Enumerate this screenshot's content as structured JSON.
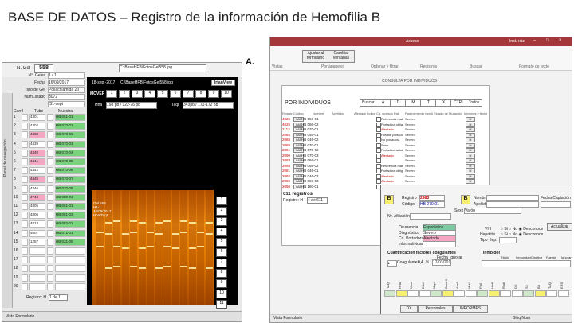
{
  "title": "BASE DE DATOS – Registro de la información de Hemofilia B",
  "labels": {
    "a": "A.",
    "b": "B."
  },
  "panel_a": {
    "gel_label": "N. Gel",
    "gel_value": "558",
    "file_path": "C:\\BaseHFB\\FotosGel558.jpg",
    "form_fields": [
      {
        "label": "N°. Geles",
        "value": "1 / 1"
      },
      {
        "label": "Fecha",
        "value": "16/09/2017"
      },
      {
        "label": "Tipo de Gel",
        "value": "Poliacrilamida 20"
      },
      {
        "label": "NumListado",
        "value": "3072"
      },
      {
        "label": "",
        "value": "/31-sept"
      }
    ],
    "viewer_date": "18-sep.-2017",
    "viewer_path": "C:\\BaseHFB\\FotosGel558.jpg",
    "viewer_button": "IrfanView",
    "mover_label": "MOVER",
    "mover_buttons": [
      "1",
      "2",
      "3",
      "4",
      "5",
      "6",
      "7",
      "8",
      "9",
      "10"
    ],
    "hha_label": "Hha",
    "hha_value": "198 pb / 122-76 pb",
    "taq_label": "TaqI",
    "taq_value": "343pb / 171-172 pb",
    "gel_overlay": [
      "Gel 558",
      "H1-1",
      "16/09/2017",
      "Hha/TaqI"
    ],
    "table_headers": [
      "Carril",
      "Tubo",
      "Muestra"
    ],
    "rows": [
      {
        "n": "1",
        "tube": "4301",
        "sample": "HB 051-01"
      },
      {
        "n": "2",
        "tube": "4302",
        "sample": "HB 070-01"
      },
      {
        "n": "3",
        "tube": "4438",
        "sample": "HB 070-02"
      },
      {
        "n": "4",
        "tube": "4439",
        "sample": "HB 070-03"
      },
      {
        "n": "5",
        "tube": "4440",
        "sample": "HB 070-04"
      },
      {
        "n": "6",
        "tube": "4441",
        "sample": "HB 070-05"
      },
      {
        "n": "7",
        "tube": "4442",
        "sample": "HB 070-06"
      },
      {
        "n": "8",
        "tube": "4445",
        "sample": "HB 070-07"
      },
      {
        "n": "9",
        "tube": "4446",
        "sample": "HB 070-08"
      },
      {
        "n": "10",
        "tube": "4743",
        "sample": "HB 080-01"
      },
      {
        "n": "11",
        "tube": "4805",
        "sample": "HB 081-01"
      },
      {
        "n": "12",
        "tube": "4806",
        "sample": "HB 081-02"
      },
      {
        "n": "13",
        "tube": "4813",
        "sample": "HB 082-01"
      },
      {
        "n": "14",
        "tube": "4007",
        "sample": "HB 071-01"
      },
      {
        "n": "15",
        "tube": "1257",
        "sample": "HB 031-05"
      },
      {
        "n": "16",
        "tube": "",
        "sample": ""
      },
      {
        "n": "17",
        "tube": "",
        "sample": ""
      },
      {
        "n": "18",
        "tube": "",
        "sample": ""
      },
      {
        "n": "19",
        "tube": "",
        "sample": ""
      },
      {
        "n": "20",
        "tube": "",
        "sample": ""
      }
    ],
    "lane_labels": [
      "1",
      "2",
      "3",
      "4",
      "5",
      "6",
      "7",
      "8",
      "9",
      "10",
      "11",
      "12",
      "13",
      "14",
      "15",
      "16",
      "17",
      "18",
      "19",
      "20",
      "21",
      "22"
    ],
    "taq_col": "Taq",
    "side_nav": "Panel de navegación",
    "records_label": "Registro: H",
    "records_value": "1 de 1",
    "status_bar": "Vista Formulario"
  },
  "panel_b": {
    "app_title": "Access",
    "window_user": "Inst. raiz",
    "ribbon_groups": [
      "Vistas",
      "Portapapeles",
      "Ordenar y filtrar",
      "Registros",
      "Buscar",
      "Formato de texto"
    ],
    "ribbon_buttons": [
      "Ajustar al formulario",
      "Cambiar ventanas"
    ],
    "search_title": "CONSULTA POR INDIVIDUOS",
    "main_heading": "POR INDIVIDUOS",
    "filter_buttons": [
      "Buscar",
      "A",
      "D",
      "M",
      "T",
      "X",
      "CTRL",
      "Todos"
    ],
    "col_headers": [
      "Registro",
      "Código",
      "Nombre",
      "Apellidos",
      "Afectado",
      "Índice",
      "Cd. portadora",
      "Pat.",
      "Padecimiento familiar",
      "Estado de Mutación",
      "Informes y fecha"
    ],
    "individuals": [
      {
        "reg": "4026",
        "code": "HB 056-01",
        "status": "Referencia materna",
        "cat": "Severo"
      },
      {
        "reg": "4025",
        "code": "HB 056-02",
        "status": "Portadora obligada",
        "cat": "Severo"
      },
      {
        "reg": "2113",
        "code": "HB 070-01",
        "status": "Afectado",
        "cat": "Severo"
      },
      {
        "reg": "2085",
        "code": "HB 046-01",
        "status": "Posible portadora",
        "cat": "Severo"
      },
      {
        "reg": "2088",
        "code": "HB 046-02",
        "status": "No portadora",
        "cat": "Severo"
      },
      {
        "reg": "2089",
        "code": "HB 070-01",
        "status": "Sano",
        "cat": "Severo"
      },
      {
        "reg": "2091",
        "code": "HB 070-02",
        "status": "Portadora asintomática",
        "cat": "Severo"
      },
      {
        "reg": "2090",
        "code": "HB 070-03",
        "status": "Afectado",
        "cat": "Severo"
      },
      {
        "reg": "2093",
        "code": "HB 068-01",
        "status": "",
        "cat": "Severo"
      },
      {
        "reg": "2094",
        "code": "HB 068-02",
        "status": "Referencia materna",
        "cat": "Severo"
      },
      {
        "reg": "2081",
        "code": "HB 046-01",
        "status": "Portadora obligada",
        "cat": "Severo"
      },
      {
        "reg": "2092",
        "code": "HB 046-02",
        "status": "Afectado",
        "cat": "Severo"
      },
      {
        "reg": "2086",
        "code": "HB 068-03",
        "status": "Afectado",
        "cat": "Severo"
      },
      {
        "reg": "2050",
        "code": "HB 160-01",
        "status": "",
        "cat": "Severo"
      }
    ],
    "records_count": "611 registros",
    "nav_label": "Registro: H",
    "nav_value": "4 de 611",
    "modal_title": "REGISTROS CLÍNICOS",
    "modal_fields": {
      "registro_label": "Registro",
      "registro_value": "2983",
      "codigo_label": "Código",
      "codigo_value": "HB 070-01",
      "nombre_label": "Nombre",
      "apellidos_label": "Apellidos",
      "fecha_label": "Fecha Captación",
      "sexo_label": "Sexo",
      "sexo_value": "Varón",
      "afiliacion_label": "Nº. Afiliación",
      "ocurrencia_label": "Ocurrencia",
      "ocurrencia_value": "Esporádico",
      "diagnostico_label": "Diagnóstico",
      "diagnostico_value": "Severo",
      "cd_portadora_label": "Cd. Portadora",
      "cd_portadora_value": "Afectado",
      "informatividad_label": "Informatividad",
      "vih_label": "VIH",
      "hepatitis_label": "Hepatitis",
      "tipo_hep_label": "Tipo Hep.",
      "opt_si": "Si",
      "opt_no": "No",
      "opt_desconoce": "Desconoce",
      "actualizar": "Actualizar",
      "cuantificacion": "Cuantificación factores coagulantes",
      "inhibidor": "Inhibidor",
      "factor_label": "Coagulante",
      "factor_value": "0,4",
      "factor_unit": "%",
      "factor_date": "17/03/2010",
      "inh_cols": [
        "Título",
        "Inmunidad",
        "Cinética",
        "Fuente",
        "Ignorar"
      ],
      "fecha_col": "Fecha",
      "ignorar_col": "Ignorar",
      "markers": [
        "TAQ",
        "HHA",
        "XmnI",
        "DdeI",
        "MspI",
        "BamHI",
        "AvaII",
        "MnlI",
        "PstI",
        "HinfI",
        "RsaI",
        "DX",
        "S2",
        "BA",
        "TAQ",
        "ERS"
      ],
      "bottom_tabs": [
        "DX",
        "Personales",
        "INFORMES"
      ]
    },
    "status_bar_left": "Vista Formulario",
    "status_bar_right": "Bloq Num"
  }
}
